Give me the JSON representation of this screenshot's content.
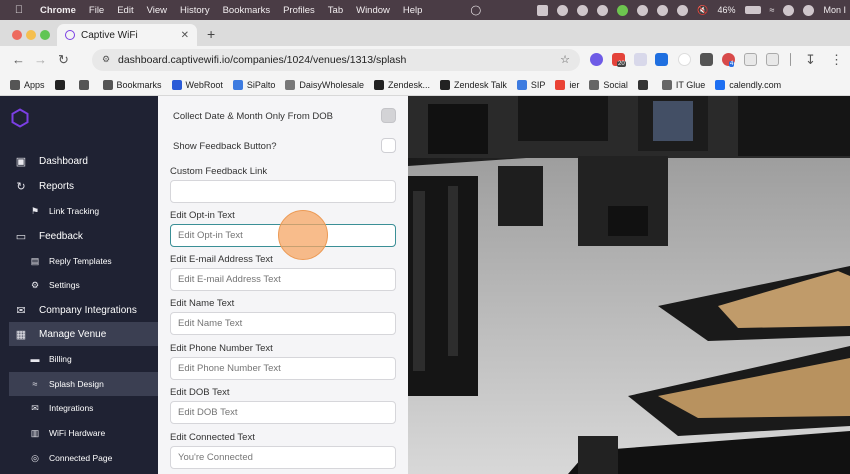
{
  "menubar": {
    "app": "Chrome",
    "items": [
      "File",
      "Edit",
      "View",
      "History",
      "Bookmarks",
      "Profiles",
      "Tab",
      "Window",
      "Help"
    ],
    "battery": "46%",
    "clock": "Mon I"
  },
  "browser": {
    "tab_title": "Captive WiFi",
    "url": "dashboard.captivewifi.io/companies/1024/venues/1313/splash",
    "ext_badge_1": "20",
    "ext_badge_2": "4"
  },
  "bookmarks": [
    {
      "label": "Apps",
      "icon": "apps-grid-icon",
      "color": "#555555"
    },
    {
      "label": "",
      "icon": "black-square-icon",
      "color": "#222222"
    },
    {
      "label": "",
      "icon": "grid-icon",
      "color": "#555555"
    },
    {
      "label": "Bookmarks",
      "icon": "star-icon",
      "color": "#555555"
    },
    {
      "label": "WebRoot",
      "icon": "webroot-icon",
      "color": "#2a5bd7"
    },
    {
      "label": "SiPalto",
      "icon": "s-logo-icon",
      "color": "#3d7be0"
    },
    {
      "label": "DaisyWholesale",
      "icon": "page-icon",
      "color": "#777777"
    },
    {
      "label": "Zendesk...",
      "icon": "zendesk-icon",
      "color": "#222222"
    },
    {
      "label": "Zendesk Talk",
      "icon": "zendesk-icon",
      "color": "#222222"
    },
    {
      "label": "SIP",
      "icon": "s-logo-icon",
      "color": "#3d7be0"
    },
    {
      "label": "ier",
      "icon": "google-icon",
      "color": "#ea4335"
    },
    {
      "label": "Social",
      "icon": "folder-icon",
      "color": "#666666"
    },
    {
      "label": "",
      "icon": "globe-icon",
      "color": "#333333"
    },
    {
      "label": "IT Glue",
      "icon": "folder-icon",
      "color": "#666666"
    },
    {
      "label": "calendly.com",
      "icon": "calendly-icon",
      "color": "#1d6ff2"
    }
  ],
  "sidebar": {
    "items": [
      {
        "label": "Dashboard",
        "icon": "dashboard-chart-icon",
        "level": "top",
        "active": false
      },
      {
        "label": "Reports",
        "icon": "refresh-arrows-icon",
        "level": "top",
        "active": false
      },
      {
        "label": "Link Tracking",
        "icon": "link-tracking-icon",
        "level": "sub",
        "active": false
      },
      {
        "label": "Feedback",
        "icon": "chat-bubble-icon",
        "level": "top",
        "active": false
      },
      {
        "label": "Reply Templates",
        "icon": "document-icon",
        "level": "sub",
        "active": false
      },
      {
        "label": "Settings",
        "icon": "gear-icon",
        "level": "sub",
        "active": false
      },
      {
        "label": "Company Integrations",
        "icon": "envelope-icon",
        "level": "top",
        "active": false
      },
      {
        "label": "Manage Venue",
        "icon": "building-icon",
        "level": "top",
        "active": true
      },
      {
        "label": "Billing",
        "icon": "card-icon",
        "level": "sub",
        "active": false
      },
      {
        "label": "Splash Design",
        "icon": "wifi-icon",
        "level": "sub",
        "active": true
      },
      {
        "label": "Integrations",
        "icon": "mail-icon",
        "level": "sub",
        "active": false
      },
      {
        "label": "WiFi Hardware",
        "icon": "router-icon",
        "level": "sub",
        "active": false
      },
      {
        "label": "Connected Page",
        "icon": "globe-icon",
        "level": "sub",
        "active": false
      }
    ]
  },
  "form": {
    "collect_dob_label": "Collect Date & Month Only From DOB",
    "collect_dob_checked": true,
    "show_feedback_label": "Show Feedback Button?",
    "show_feedback_checked": false,
    "fields": [
      {
        "label": "Custom Feedback Link",
        "value": "",
        "placeholder": ""
      },
      {
        "label": "Edit Opt-in Text",
        "value": "",
        "placeholder": "Edit Opt-in Text",
        "focused": true
      },
      {
        "label": "Edit E-mail Address Text",
        "value": "",
        "placeholder": "Edit E-mail Address Text"
      },
      {
        "label": "Edit Name Text",
        "value": "",
        "placeholder": "Edit Name Text"
      },
      {
        "label": "Edit Phone Number Text",
        "value": "",
        "placeholder": "Edit Phone Number Text"
      },
      {
        "label": "Edit DOB Text",
        "value": "",
        "placeholder": "Edit DOB Text"
      },
      {
        "label": "Edit Connected Text",
        "value": "You're Connected",
        "placeholder": ""
      }
    ]
  },
  "colors": {
    "sidebar_bg": "#1f2233",
    "sidebar_active": "#3b3f52",
    "logo": "#7b3fe4",
    "focus_border": "#3b8f96",
    "cursor_highlight": "#f6a664"
  }
}
